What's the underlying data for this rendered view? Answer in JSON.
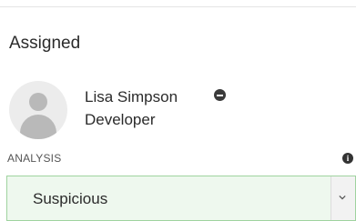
{
  "section": {
    "title": "Assigned"
  },
  "assignee": {
    "name": "Lisa Simpson",
    "role": "Developer",
    "avatar_icon": "user-avatar-icon",
    "remove_icon": "minus-circle-icon"
  },
  "analysis": {
    "label": "ANALYSIS",
    "info_icon": "info-circle-icon",
    "selected": "Suspicious",
    "dropdown_icon": "chevron-down-icon"
  },
  "colors": {
    "select_border": "#9fd39f",
    "select_background": "#eef8ee",
    "icon_dark": "#333333"
  }
}
